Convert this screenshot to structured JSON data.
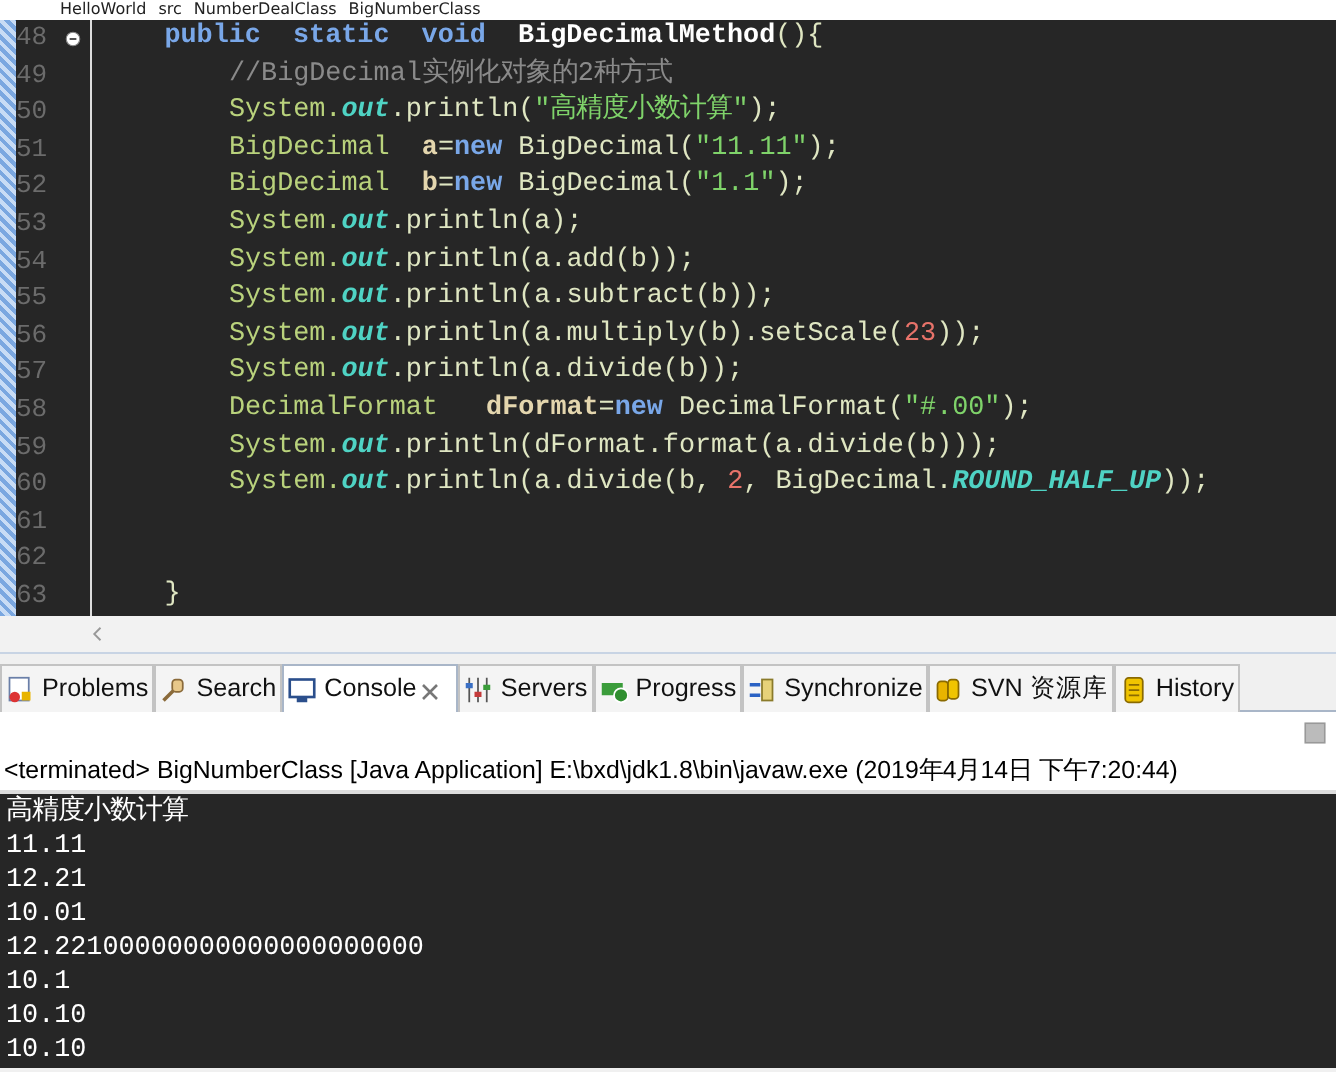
{
  "breadcrumb": [
    "HelloWorld",
    "src",
    "NumberDealClass",
    "BigNumberClass"
  ],
  "editor": {
    "lines": [
      {
        "number": "48",
        "folded": false,
        "tokens": [
          {
            "kind": "keyword",
            "text": "public  static  void  "
          },
          {
            "kind": "method",
            "text": "BigDecimalMethod"
          },
          {
            "kind": "plain",
            "text": "(){"
          }
        ],
        "children": [
          {
            "number": "49",
            "tokens": [
              {
                "kind": "comment",
                "text": "//BigDecimal实例化对象的2种方式"
              }
            ]
          },
          {
            "number": "50",
            "tokens": [
              {
                "kind": "type",
                "text": "System."
              },
              {
                "kind": "field",
                "text": "out"
              },
              {
                "kind": "plain",
                "text": ".println("
              },
              {
                "kind": "string",
                "text": "\"高精度小数计算\""
              },
              {
                "kind": "plain",
                "text": ");"
              }
            ]
          },
          {
            "number": "51",
            "tokens": [
              {
                "kind": "type",
                "text": "BigDecimal  "
              },
              {
                "kind": "var",
                "text": "a"
              },
              {
                "kind": "plain",
                "text": "="
              },
              {
                "kind": "keyword",
                "text": "new"
              },
              {
                "kind": "plain",
                "text": " BigDecimal("
              },
              {
                "kind": "string",
                "text": "\"11.11\""
              },
              {
                "kind": "plain",
                "text": ");"
              }
            ]
          },
          {
            "number": "52",
            "tokens": [
              {
                "kind": "type",
                "text": "BigDecimal  "
              },
              {
                "kind": "var",
                "text": "b"
              },
              {
                "kind": "plain",
                "text": "="
              },
              {
                "kind": "keyword",
                "text": "new"
              },
              {
                "kind": "plain",
                "text": " BigDecimal("
              },
              {
                "kind": "string",
                "text": "\"1.1\""
              },
              {
                "kind": "plain",
                "text": ");"
              }
            ]
          },
          {
            "number": "53",
            "tokens": [
              {
                "kind": "type",
                "text": "System."
              },
              {
                "kind": "field",
                "text": "out"
              },
              {
                "kind": "plain",
                "text": ".println(a);"
              }
            ]
          },
          {
            "number": "54",
            "tokens": [
              {
                "kind": "type",
                "text": "System."
              },
              {
                "kind": "field",
                "text": "out"
              },
              {
                "kind": "plain",
                "text": ".println(a.add(b));"
              }
            ]
          },
          {
            "number": "55",
            "tokens": [
              {
                "kind": "type",
                "text": "System."
              },
              {
                "kind": "field",
                "text": "out"
              },
              {
                "kind": "plain",
                "text": ".println(a.subtract(b));"
              }
            ]
          },
          {
            "number": "56",
            "tokens": [
              {
                "kind": "type",
                "text": "System."
              },
              {
                "kind": "field",
                "text": "out"
              },
              {
                "kind": "plain",
                "text": ".println(a.multiply(b).setScale("
              },
              {
                "kind": "number",
                "text": "23"
              },
              {
                "kind": "plain",
                "text": "));"
              }
            ]
          },
          {
            "number": "57",
            "tokens": [
              {
                "kind": "type",
                "text": "System."
              },
              {
                "kind": "field",
                "text": "out"
              },
              {
                "kind": "plain",
                "text": ".println(a.divide(b));"
              }
            ]
          },
          {
            "number": "58",
            "tokens": [
              {
                "kind": "type",
                "text": "DecimalFormat   "
              },
              {
                "kind": "var",
                "text": "dFormat"
              },
              {
                "kind": "plain",
                "text": "="
              },
              {
                "kind": "keyword",
                "text": "new"
              },
              {
                "kind": "plain",
                "text": " DecimalFormat("
              },
              {
                "kind": "string",
                "text": "\"#.00\""
              },
              {
                "kind": "plain",
                "text": ");"
              }
            ]
          },
          {
            "number": "59",
            "tokens": [
              {
                "kind": "type",
                "text": "System."
              },
              {
                "kind": "field",
                "text": "out"
              },
              {
                "kind": "plain",
                "text": ".println(dFormat.format(a.divide(b)));"
              }
            ]
          },
          {
            "number": "60",
            "tokens": [
              {
                "kind": "type",
                "text": "System."
              },
              {
                "kind": "field",
                "text": "out"
              },
              {
                "kind": "plain",
                "text": ".println(a.divide(b, "
              },
              {
                "kind": "number",
                "text": "2"
              },
              {
                "kind": "plain",
                "text": ", BigDecimal."
              },
              {
                "kind": "field",
                "text": "ROUND_HALF_UP"
              },
              {
                "kind": "plain",
                "text": "));"
              }
            ]
          },
          {
            "number": "61"
          },
          {
            "number": "62"
          }
        ]
      },
      {
        "number": "63",
        "tokens": [
          {
            "kind": "plain",
            "text": "}"
          }
        ]
      }
    ]
  },
  "tabs": [
    {
      "label": "Problems",
      "selected": false
    },
    {
      "label": "Search",
      "selected": false
    },
    {
      "label": "Console",
      "selected": true
    },
    {
      "label": "Servers",
      "selected": false
    },
    {
      "label": "Progress",
      "selected": false
    },
    {
      "label": "Synchronize",
      "selected": false
    },
    {
      "label": "SVN 资源库",
      "selected": false
    },
    {
      "label": "History",
      "selected": false
    }
  ],
  "console": {
    "header": "<terminated> BigNumberClass [Java Application] E:\\bxd\\jdk1.8\\bin\\javaw.exe (2019年4月14日 下午7:20:44)",
    "lines": [
      "高精度小数计算",
      "11.11",
      "12.21",
      "10.01",
      "12.22100000000000000000000",
      "10.1",
      "10.10",
      "10.10"
    ]
  }
}
